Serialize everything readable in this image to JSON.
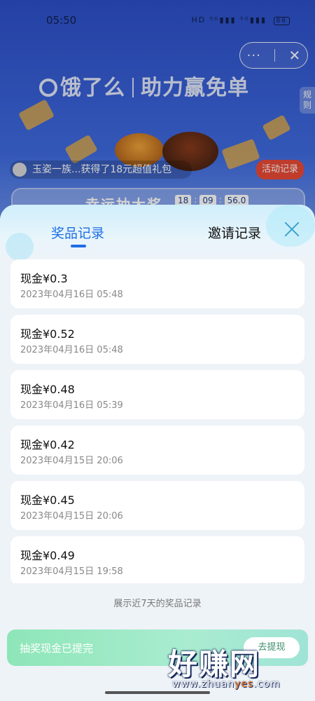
{
  "status_bar": {
    "time": "05:50",
    "icons": "HD ⁵ᴳ▮▮▮ ⁵ᴳ▮▮▮",
    "battery": "86"
  },
  "background": {
    "capsule": {
      "more_icon": "more-dots-icon",
      "close_icon": "close-icon"
    },
    "hero_brand": "饿了么",
    "hero_slogan": "助力赢免单",
    "rule_tab": "规则",
    "marquee_text": "玉姿一族...获得了18元超值礼包",
    "activity_button": "活动记录",
    "lucky_title": "幸运抽大奖",
    "timer": {
      "h": "18",
      "m": "09",
      "s": "56.0"
    }
  },
  "sheet": {
    "tabs": [
      {
        "label": "奖品记录",
        "active": true
      },
      {
        "label": "邀请记录",
        "active": false
      }
    ],
    "records": [
      {
        "amount": "现金¥0.3",
        "time": "2023年04月16日 05:48"
      },
      {
        "amount": "现金¥0.52",
        "time": "2023年04月16日 05:48"
      },
      {
        "amount": "现金¥0.48",
        "time": "2023年04月16日 05:39"
      },
      {
        "amount": "现金¥0.42",
        "time": "2023年04月15日 20:06"
      },
      {
        "amount": "现金¥0.45",
        "time": "2023年04月15日 20:06"
      },
      {
        "amount": "现金¥0.49",
        "time": "2023年04月15日 19:58"
      }
    ],
    "footnote": "展示近7天的奖品记录",
    "bottom_text": "抽奖现金已提完",
    "bottom_button": "去提现"
  },
  "watermark": {
    "main": "好赚网",
    "sub_prefix": "www.zhuan",
    "sub_accent": "yes",
    "sub_suffix": ".com"
  },
  "colors": {
    "accent_blue": "#1e6ee6",
    "close_icon": "#3fa2cf",
    "activity_red": "#e94a36",
    "bottom_green": "#8ee6b8"
  }
}
